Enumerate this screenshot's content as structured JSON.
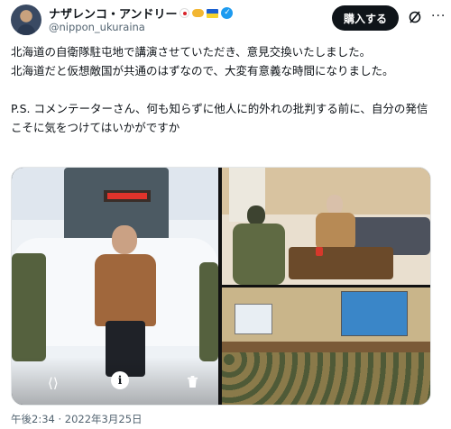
{
  "author": {
    "display_name": "ナザレンコ・アンドリー",
    "handle": "@nippon_ukuraina",
    "badges": [
      "jp-flag-icon",
      "handshake-icon",
      "ua-flag-icon",
      "verified-badge-icon"
    ]
  },
  "header": {
    "follow_label": "購入する",
    "icons": [
      "grok-icon",
      "more-icon"
    ]
  },
  "tweet": {
    "text": "北海道の自衛隊駐屯地で講演させていただき、意見交換いたしました。\n北海道だと仮想敵国が共通のはずなので、大変有意義な時間になりました。\n\nP.S. コメンテーターさん、何も知らずに他人に的外れの批判する前に、自分の発信こそに気をつけてはいかがですか",
    "timestamp": "午後2:34 · 2022年3月25日"
  },
  "media": {
    "photos": [
      {
        "subject": "man seated in front of snowy monument",
        "actions": [
          "share-icon",
          "info-icon",
          "trash-icon"
        ]
      },
      {
        "subject": "meeting in reception room"
      },
      {
        "subject": "lecture hall with soldiers"
      }
    ],
    "info_label": "i"
  },
  "colors": {
    "text": "#0f1419",
    "muted": "#536471",
    "verified": "#1d9bf0",
    "button": "#0f1419"
  }
}
